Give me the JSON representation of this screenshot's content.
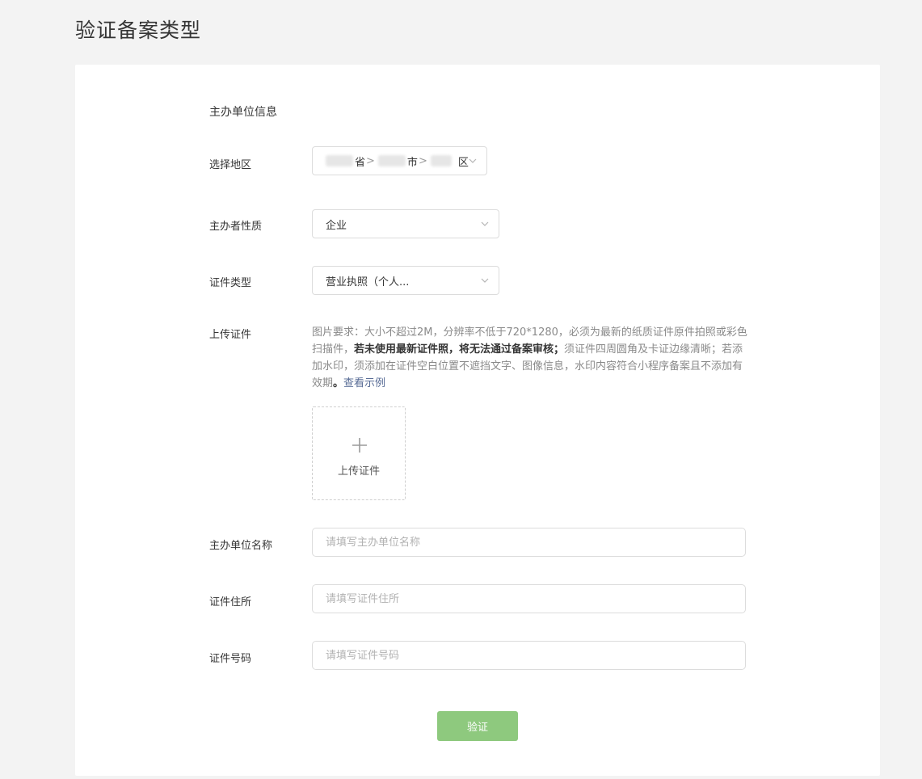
{
  "page_title": "验证备案类型",
  "section_title": "主办单位信息",
  "region": {
    "label": "选择地区",
    "province_suffix": "省",
    "city_suffix": "市",
    "district_suffix": "区",
    "separator": ">"
  },
  "sponsor_nature": {
    "label": "主办者性质",
    "value": "企业"
  },
  "cert_type": {
    "label": "证件类型",
    "value": "营业执照（个人..."
  },
  "upload": {
    "label": "上传证件",
    "hint_part1": "图片要求：大小不超过2M，分辨率不低于720*1280，必须为最新的纸质证件原件拍照或彩色扫描件，",
    "hint_bold": "若未使用最新证件照，将无法通过备案审核；",
    "hint_part2": "须证件四周圆角及卡证边缘清晰；若添加水印，须添加在证件空白位置不遮挡文字、图像信息，水印内容符合小程序备案且不添加有效期",
    "hint_bold_end": "。",
    "example_link": "查看示例",
    "button_text": "上传证件"
  },
  "org_name": {
    "label": "主办单位名称",
    "placeholder": "请填写主办单位名称",
    "value": ""
  },
  "cert_address": {
    "label": "证件住所",
    "placeholder": "请填写证件住所",
    "value": ""
  },
  "cert_number": {
    "label": "证件号码",
    "placeholder": "请填写证件号码",
    "value": ""
  },
  "verify_button": "验证",
  "colors": {
    "primary": "#8ec97e",
    "link": "#576b95",
    "background": "#f3f3f3"
  },
  "icons": {
    "dropdown": "chevron-down-icon",
    "upload": "plus-icon"
  }
}
